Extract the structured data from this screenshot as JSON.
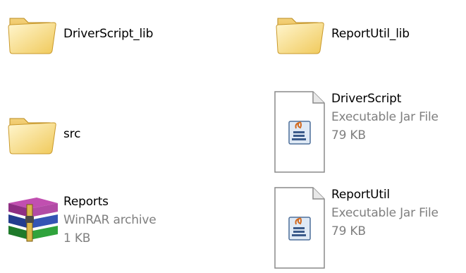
{
  "items": [
    {
      "icon": "folder-icon",
      "name": "DriverScript_lib"
    },
    {
      "icon": "folder-icon",
      "name": "ReportUtil_lib"
    },
    {
      "icon": "folder-icon",
      "name": "src"
    },
    {
      "icon": "jar-file-icon",
      "name": "DriverScript",
      "type": "Executable Jar File",
      "size": "79 KB"
    },
    {
      "icon": "winrar-archive-icon",
      "name": "Reports",
      "type": "WinRAR archive",
      "size": "1 KB"
    },
    {
      "icon": "jar-file-icon",
      "name": "ReportUtil",
      "type": "Executable Jar File",
      "size": "79 KB"
    }
  ],
  "colors": {
    "folder_light": "#fbe9a4",
    "folder_dark": "#e8b73a",
    "meta_text": "#7f7f7f"
  }
}
